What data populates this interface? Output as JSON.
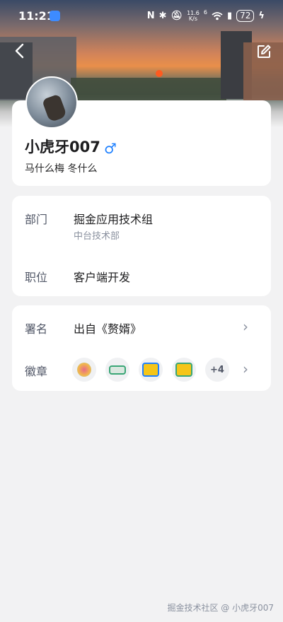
{
  "status_bar": {
    "time": "11:21",
    "net_speed_value": "11.6",
    "net_speed_unit": "K/s",
    "signal": "6",
    "battery": "72"
  },
  "profile": {
    "name": "小虎牙007",
    "gender_symbol": "♂",
    "bio": "马什么梅 冬什么"
  },
  "info": {
    "department_label": "部门",
    "department_value": "掘金应用技术组",
    "department_sub": "中台技术部",
    "position_label": "职位",
    "position_value": "客户端开发"
  },
  "extra": {
    "signature_label": "署名",
    "signature_value": "出自《赘婿》",
    "badges_label": "徽章",
    "badges_more": "+4"
  },
  "watermark": "掘金技术社区 @ 小虎牙007",
  "colors": {
    "accent": "#1e80ff",
    "page_bg": "#f2f2f3"
  }
}
